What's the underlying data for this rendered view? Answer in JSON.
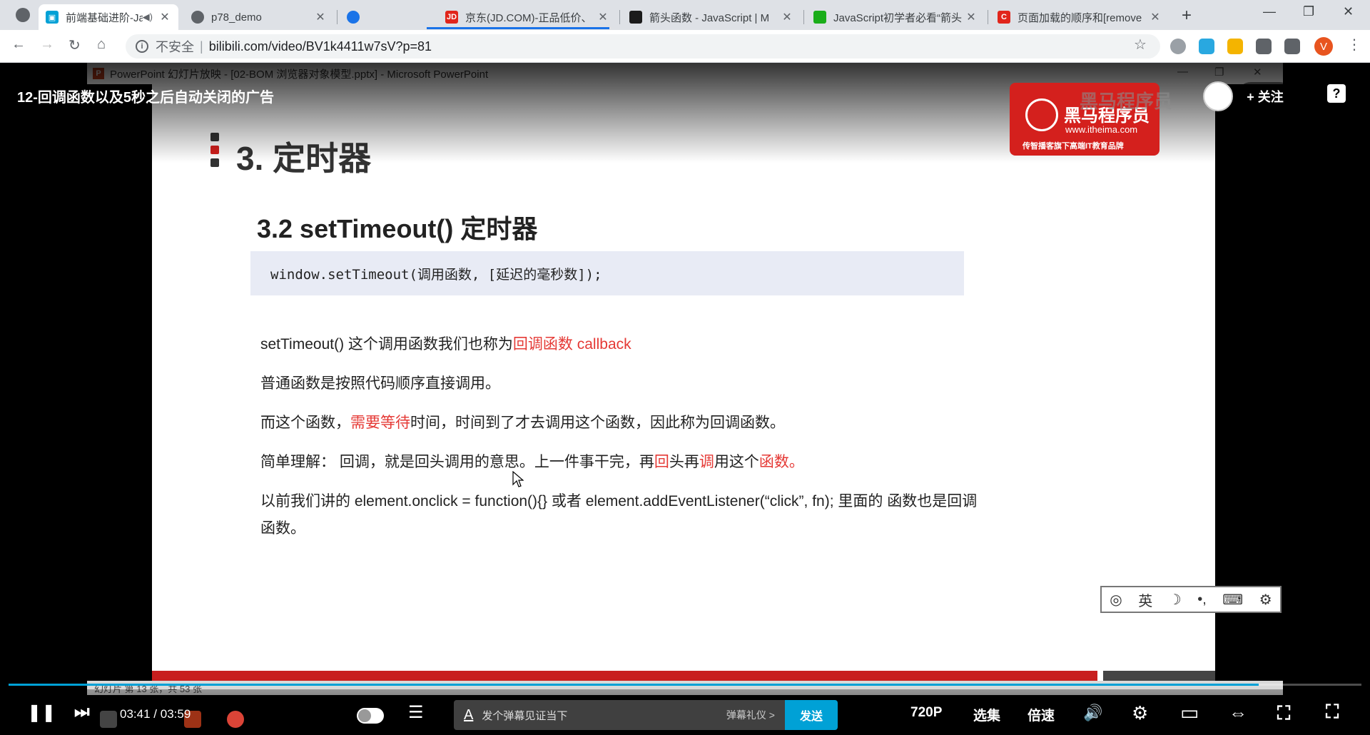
{
  "browser": {
    "tabs": [
      {
        "title": "前端基础进阶-JavaScr",
        "favicon_color": "#00a1d6",
        "active": true,
        "audio": true
      },
      {
        "title": "p78_demo",
        "favicon_color": "#5f6368",
        "active": false
      },
      {
        "title": "",
        "favicon_color": "#1a73e8",
        "active": false
      },
      {
        "title": "京东(JD.COM)-正品低价、",
        "favicon_color": "#e1251b",
        "favicon_text": "JD",
        "active": false
      },
      {
        "title": "箭头函数 - JavaScript | M",
        "favicon_color": "#1b1b1b",
        "active": false
      },
      {
        "title": "JavaScript初学者必看“箭头",
        "favicon_color": "#1aad19",
        "active": false
      },
      {
        "title": "页面加载的顺序和[remove",
        "favicon_color": "#e1251b",
        "favicon_text": "C",
        "active": false
      }
    ],
    "new_tab": "+",
    "window_controls": {
      "minimize": "—",
      "maximize": "❐",
      "close": "✕"
    },
    "nav": {
      "back": "←",
      "forward": "→",
      "reload": "↻",
      "home": "⌂"
    },
    "security_label": "不安全",
    "url": "bilibili.com/video/BV1k4411w7sV?p=81",
    "avatar_letter": "V"
  },
  "video": {
    "title": "12-回调函数以及5秒之后自动关闭的广告",
    "follow_label": "+ 关注",
    "help_label": "?",
    "ppt_window_title": "PowerPoint 幻灯片放映 - [02-BOM 浏览器对象模型.pptx] - Microsoft PowerPoint",
    "ppt_icon_letter": "P",
    "logo": {
      "name": "黑马程序员",
      "url": "www.itheima.com",
      "tagline": "传智播客旗下高端IT教育品牌"
    },
    "watermark": "黑马程序员",
    "slide": {
      "heading": "3. 定时器",
      "subheading": "3.2 setTimeout() 定时器",
      "code": "window.setTimeout(调用函数, [延迟的毫秒数]);",
      "p1_a": "setTimeout() 这个调用函数我们也称为",
      "p1_b": "回调函数 callback",
      "p2": "普通函数是按照代码顺序直接调用。",
      "p3_a": "而这个函数，",
      "p3_b": "需要等待",
      "p3_c": "时间，时间到了才去调用这个函数，因此称为回调函数。",
      "p4_a": "简单理解：  回调，就是回头调用的意思。上一件事干完，再",
      "p4_b": "回",
      "p4_c": "头再",
      "p4_d": "调",
      "p4_e": "用这个",
      "p4_f": "函数。",
      "p5_line1": "以前我们讲的  element.onclick = function(){}  或者  element.addEventListener(“click”, fn);  里面的 函数也是回调",
      "p5_line2": "函数。"
    },
    "ime": {
      "lang": "英",
      "moon": "☽",
      "punct": "•,",
      "keyboard": "⌨",
      "settings": "⚙"
    },
    "ppt_status": "幻灯片 第 13 张，共 53 张",
    "progress": 0.924,
    "controls": {
      "play_pause": "❚❚",
      "next": "⏭",
      "time_current": "03:41",
      "time_sep": "/",
      "time_total": "03:59",
      "danmaku_placeholder": "发个弹幕见证当下",
      "danmaku_gift": "弹幕礼仪 >",
      "send": "发送",
      "quality": "720P",
      "episodes": "选集",
      "speed": "倍速",
      "volume": "🔊",
      "settings": "⚙",
      "pip": "▭",
      "widescreen": "⇔",
      "fullscreen": "⛶",
      "danmaku_settings": "☰"
    },
    "colors": {
      "accent": "#00a1d6",
      "highlight_red": "#e53935",
      "ppt_red": "#c81e1e"
    }
  }
}
